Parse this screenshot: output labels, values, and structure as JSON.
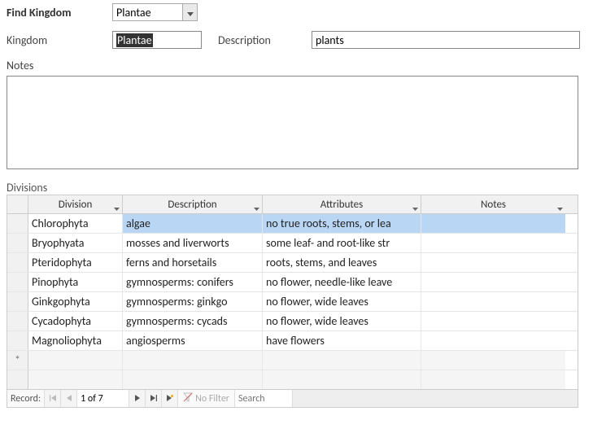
{
  "find": {
    "label": "Find Kingdom",
    "value": "Plantae"
  },
  "fields": {
    "kingdom_label": "Kingdom",
    "kingdom_value": "Plantae",
    "description_label": "Description",
    "description_value": "plants",
    "notes_label": "Notes",
    "notes_value": ""
  },
  "subform": {
    "label": "Divisions",
    "columns": {
      "division": "Division",
      "description": "Description",
      "attributes": "Attributes",
      "notes": "Notes"
    },
    "rows": [
      {
        "division": "Chlorophyta",
        "description": "algae",
        "attributes": "no true roots, stems, or lea",
        "notes": ""
      },
      {
        "division": "Bryophyata",
        "description": "mosses and liverworts",
        "attributes": "some leaf- and root-like str",
        "notes": ""
      },
      {
        "division": "Pteridophyta",
        "description": "ferns and horsetails",
        "attributes": "roots, stems, and leaves",
        "notes": ""
      },
      {
        "division": "Pinophyta",
        "description": "gymnosperms: conifers",
        "attributes": "no flower, needle-like leave",
        "notes": ""
      },
      {
        "division": "Ginkgophyta",
        "description": "gymnosperms: ginkgo",
        "attributes": "no flower, wide leaves",
        "notes": ""
      },
      {
        "division": "Cycadophyta",
        "description": "gymnosperms: cycads",
        "attributes": "no flower, wide leaves",
        "notes": ""
      },
      {
        "division": "Magnoliophyta",
        "description": "angiosperms",
        "attributes": "have flowers",
        "notes": ""
      }
    ],
    "new_row_marker": "*"
  },
  "nav": {
    "record_label": "Record:",
    "position": "1 of 7",
    "no_filter": "No Filter",
    "search_placeholder": "Search"
  }
}
